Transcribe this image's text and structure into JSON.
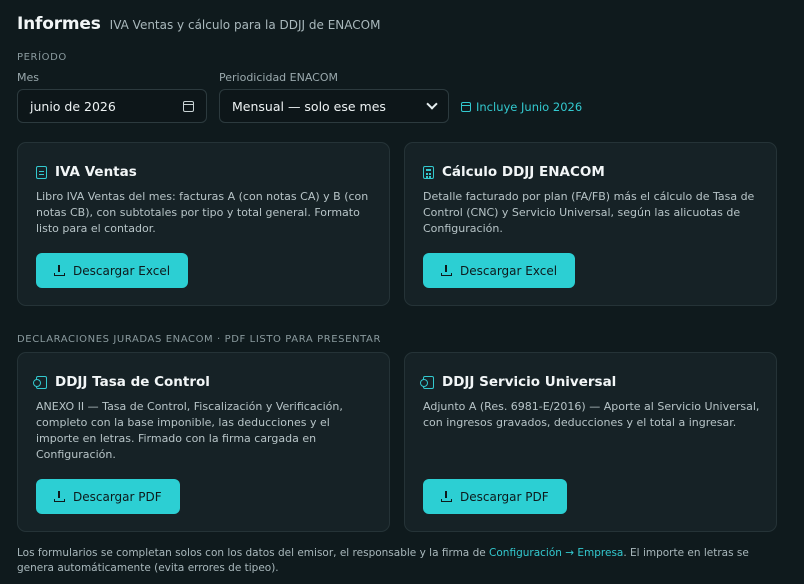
{
  "header": {
    "title": "Informes",
    "subtitle": "IVA Ventas y cálculo para la DDJJ de ENACOM"
  },
  "period": {
    "section_label": "PERÍODO",
    "month_label": "Mes",
    "month_value": "junio de 2026",
    "periodicity_label": "Periodicidad ENACOM",
    "periodicity_value": "Mensual — solo ese mes",
    "includes_text": "Incluye Junio 2026"
  },
  "cards": {
    "iva": {
      "title": "IVA Ventas",
      "description": "Libro IVA Ventas del mes: facturas A (con notas CA) y B (con notas CB), con subtotales por tipo y total general. Formato listo para el contador.",
      "button": "Descargar Excel"
    },
    "ddjj_calc": {
      "title": "Cálculo DDJJ ENACOM",
      "description": "Detalle facturado por plan (FA/FB) más el cálculo de Tasa de Control (CNC) y Servicio Universal, según las alicuotas de Configuración.",
      "button": "Descargar Excel"
    },
    "tasa": {
      "title": "DDJJ Tasa de Control",
      "description": "ANEXO II — Tasa de Control, Fiscalización y Verificación, completo con la base imponible, las deducciones y el importe en letras. Firmado con la firma cargada en Configuración.",
      "button": "Descargar PDF"
    },
    "servicio": {
      "title": "DDJJ Servicio Universal",
      "description": "Adjunto A (Res. 6981-E/2016) — Aporte al Servicio Universal, con ingresos gravados, deducciones y el total a ingresar.",
      "button": "Descargar PDF"
    }
  },
  "ddjj_section_label": "DECLARACIONES JURADAS ENACOM · PDF LISTO PARA PRESENTAR",
  "footer": {
    "text_before": "Los formularios se completan solos con los datos del emisor, el responsable y la firma de ",
    "link": "Configuración → Empresa",
    "text_after": ". El importe en letras se genera automáticamente (evita errores de tipeo)."
  },
  "colors": {
    "background": "#0f1a1d",
    "card": "#162226",
    "accent": "#2ccfd3"
  },
  "icons": [
    "calendar-icon",
    "chevron-down-icon",
    "document-icon",
    "calculator-icon",
    "signed-document-icon",
    "download-icon"
  ]
}
